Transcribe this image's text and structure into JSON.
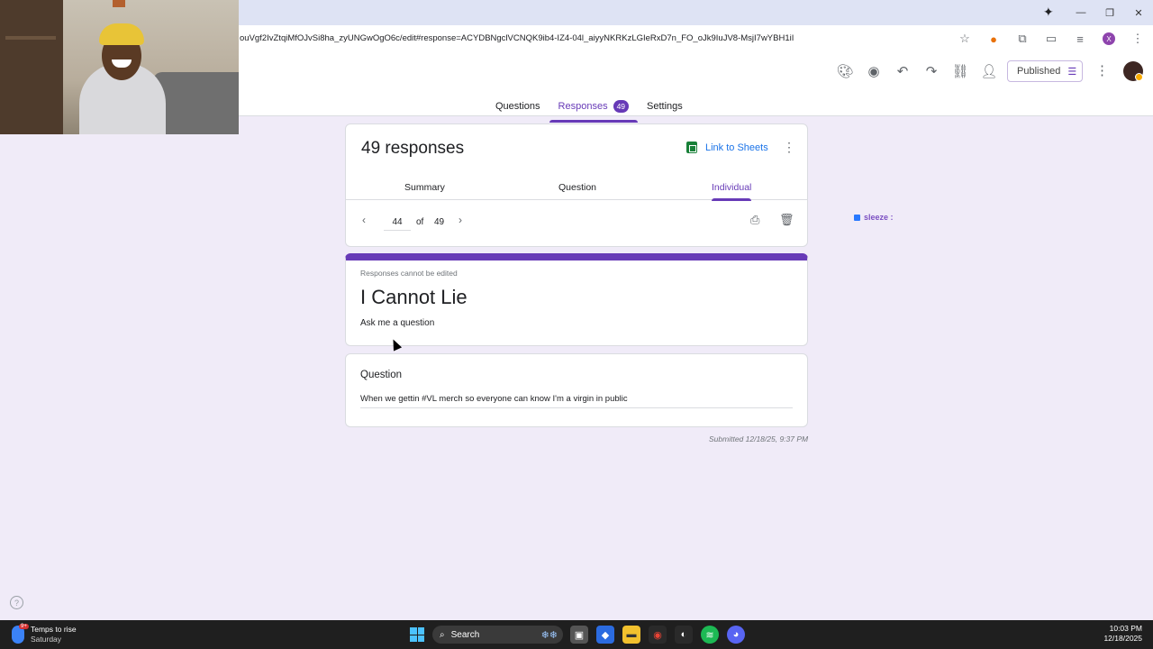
{
  "browser": {
    "url": "ouVgf2IvZtqiMfOJvSi8ha_zyUNGwOgO6c/edit#response=ACYDBNgclVCNQK9ib4-IZ4-04l_aiyyNKRKzLGIeRxD7n_FO_oJk9IuJV8-MsjI7wYBH1iI",
    "window_controls": {
      "minimize": "—",
      "maximize": "❐",
      "close": "✕"
    },
    "profile_initial": "X",
    "gemini_icon": "✦"
  },
  "forms_header": {
    "published_label": "Published",
    "tabs": [
      {
        "label": "Questions"
      },
      {
        "label": "Responses",
        "badge": "49"
      },
      {
        "label": "Settings"
      }
    ]
  },
  "responses": {
    "title": "49 responses",
    "link_to_sheets": "Link to Sheets",
    "sub_tabs": [
      "Summary",
      "Question",
      "Individual"
    ],
    "pager": {
      "current": "44",
      "of_label": "of",
      "total": "49"
    }
  },
  "form": {
    "note": "Responses cannot be edited",
    "title": "I Cannot Lie",
    "description": "Ask me a question"
  },
  "question": {
    "title": "Question",
    "answer": "When we gettin #VL merch so everyone can know I'm a virgin in public"
  },
  "submitted": "Submitted 12/18/25, 9:37 PM",
  "side_label": "sleeze :",
  "taskbar": {
    "weather_line1": "Temps to rise",
    "weather_line2": "Saturday",
    "weather_badge": "9+",
    "search_placeholder": "Search",
    "time": "10:03 PM",
    "date": "12/18/2025"
  },
  "colors": {
    "accent": "#673ab7",
    "background": "#f0ebf8",
    "link": "#1a73e8",
    "sheets": "#188038"
  }
}
